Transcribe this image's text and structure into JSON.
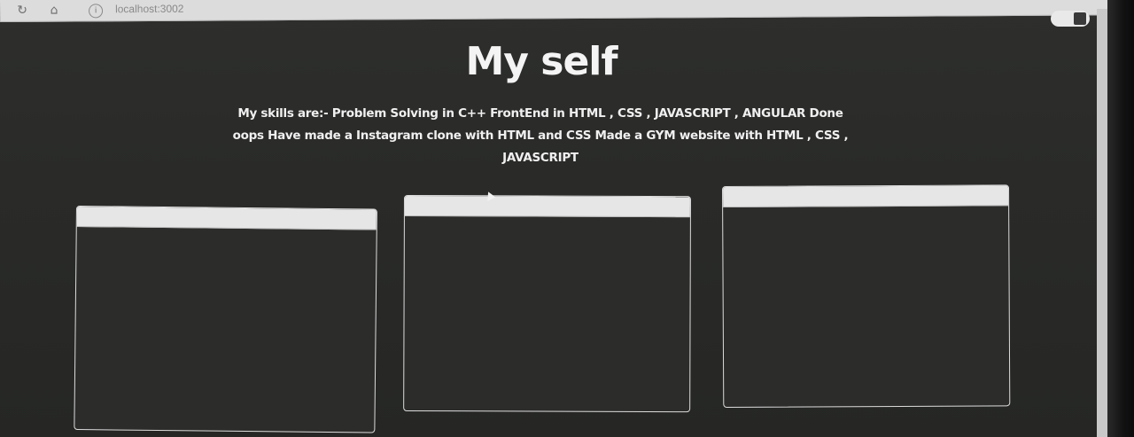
{
  "browser": {
    "url": "localhost:3002",
    "icons": [
      "reload-icon",
      "home-icon",
      "info-icon"
    ]
  },
  "page": {
    "title": "My self",
    "skills": "My skills are:- Problem Solving in C++ FrontEnd in HTML , CSS , JAVASCRIPT , ANGULAR Done oops Have made a Instagram clone with HTML and CSS Made a GYM website with HTML , CSS , JAVASCRIPT"
  },
  "cards": [
    {
      "id": "card-1"
    },
    {
      "id": "card-2"
    },
    {
      "id": "card-3"
    }
  ],
  "colors": {
    "background": "#2a2b29",
    "text": "#f4f4f4",
    "card_header": "#e6e6e6"
  }
}
